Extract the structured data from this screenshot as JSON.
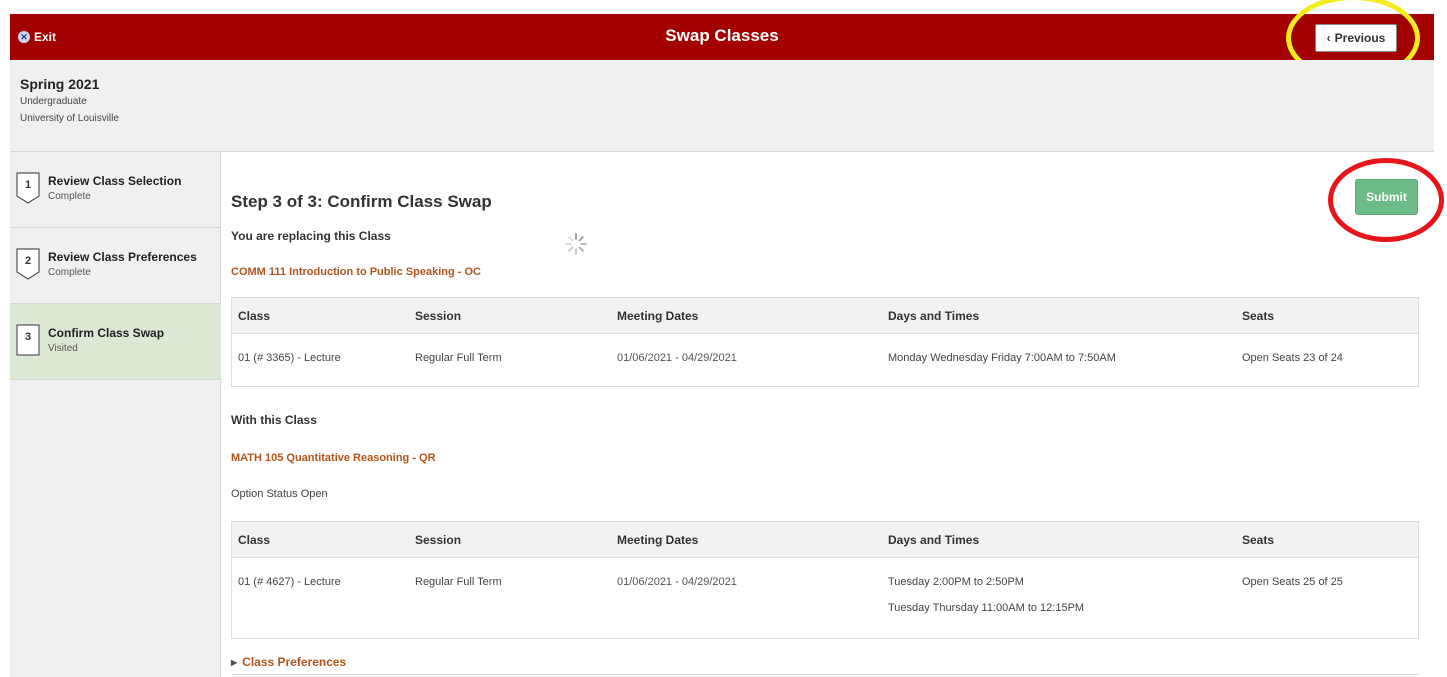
{
  "header": {
    "exit_label": "Exit",
    "title": "Swap Classes",
    "previous_label": "Previous",
    "brand_color": "#a30000"
  },
  "term": {
    "name": "Spring 2021",
    "career": "Undergraduate",
    "institution": "University of Louisville"
  },
  "steps": [
    {
      "number": "1",
      "title": "Review Class Selection",
      "status": "Complete"
    },
    {
      "number": "2",
      "title": "Review Class Preferences",
      "status": "Complete"
    },
    {
      "number": "3",
      "title": "Confirm Class Swap",
      "status": "Visited"
    }
  ],
  "main": {
    "heading": "Step 3 of 3: Confirm Class Swap",
    "submit_label": "Submit",
    "replacing_label": "You are replacing this Class",
    "replacing_course": "COMM 111   Introduction to Public Speaking - OC",
    "with_label": "With this Class",
    "with_course": "MATH 105   Quantitative Reasoning - QR",
    "option_status": "Option Status  Open",
    "class_preferences_label": "Class Preferences"
  },
  "table_headers": [
    "Class",
    "Session",
    "Meeting Dates",
    "Days and Times",
    "Seats"
  ],
  "replacing_row": {
    "class": "01 (# 3365) - Lecture",
    "session": "Regular Full Term",
    "dates": "01/06/2021 - 04/29/2021",
    "times": "Monday Wednesday Friday   7:00AM to 7:50AM",
    "seats": "Open Seats 23 of 24"
  },
  "with_row": {
    "class": "01 (# 4627) - Lecture",
    "session": "Regular Full Term",
    "dates": "01/06/2021 - 04/29/2021",
    "times_1": "Tuesday   2:00PM to 2:50PM",
    "times_2": "Tuesday Thursday   11:00AM to 12:15PM",
    "seats": "Open Seats 25 of 25"
  },
  "annotations": {
    "previous_ring_color": "#f2ec1c",
    "submit_ring_color": "#e8141c"
  },
  "icons": [
    "exit-icon",
    "chevron-left-icon",
    "loading-spinner-icon",
    "caret-right-icon"
  ]
}
